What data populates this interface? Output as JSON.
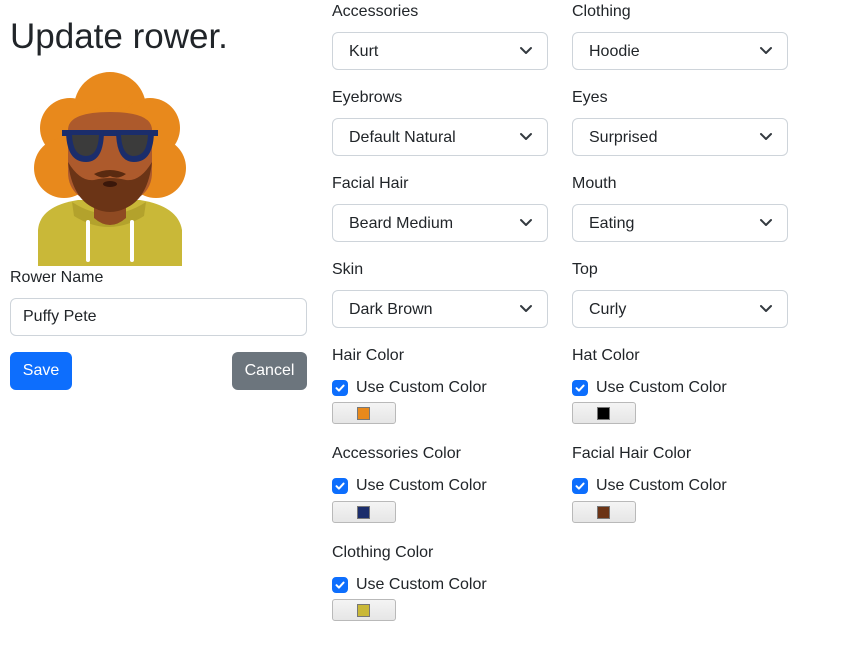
{
  "page": {
    "title": "Update rower."
  },
  "rower": {
    "name_label": "Rower Name",
    "name_value": "Puffy Pete",
    "save_label": "Save",
    "cancel_label": "Cancel"
  },
  "selects": {
    "accessories": {
      "label": "Accessories",
      "value": "Kurt"
    },
    "clothing": {
      "label": "Clothing",
      "value": "Hoodie"
    },
    "eyebrows": {
      "label": "Eyebrows",
      "value": "Default Natural"
    },
    "eyes": {
      "label": "Eyes",
      "value": "Surprised"
    },
    "facial_hair": {
      "label": "Facial Hair",
      "value": "Beard Medium"
    },
    "mouth": {
      "label": "Mouth",
      "value": "Eating"
    },
    "skin": {
      "label": "Skin",
      "value": "Dark Brown"
    },
    "top": {
      "label": "Top",
      "value": "Curly"
    }
  },
  "colors": {
    "hair": {
      "label": "Hair Color",
      "checkbox_label": "Use Custom Color",
      "checked": true,
      "color": "#e8891c"
    },
    "hat": {
      "label": "Hat Color",
      "checkbox_label": "Use Custom Color",
      "checked": true,
      "color": "#000000"
    },
    "accessories": {
      "label": "Accessories Color",
      "checkbox_label": "Use Custom Color",
      "checked": true,
      "color": "#1b2d6b"
    },
    "facial_hair": {
      "label": "Facial Hair Color",
      "checkbox_label": "Use Custom Color",
      "checked": true,
      "color": "#6b3416"
    },
    "clothing": {
      "label": "Clothing Color",
      "checkbox_label": "Use Custom Color",
      "checked": true,
      "color": "#c9b838"
    }
  },
  "theme": {
    "primary": "#0d6efd",
    "secondary": "#6c757d",
    "skin": "#ad5a2c"
  }
}
